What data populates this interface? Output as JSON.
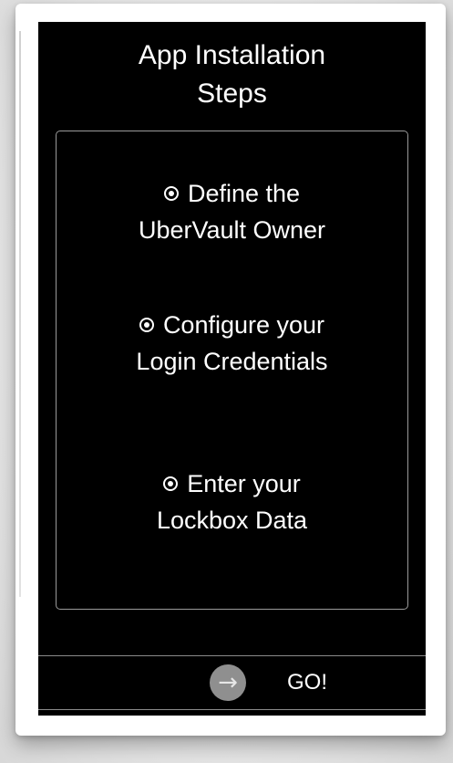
{
  "title": "App Installation\nSteps",
  "steps": [
    {
      "label": "Define the\nUberVault Owner",
      "icon": "radio-selected-icon"
    },
    {
      "label": "Configure your\nLogin Credentials",
      "icon": "radio-selected-icon"
    },
    {
      "label": "Enter your\nLockbox Data",
      "icon": "radio-selected-icon"
    }
  ],
  "go_button": {
    "icon": "right-arrow-icon",
    "icon_glyph": "→",
    "label": "GO!"
  },
  "colors": {
    "screen_bg": "#000000",
    "text": "#ffffff",
    "frame": "#ffffff",
    "arrow_circle": "#8f8f8f"
  }
}
